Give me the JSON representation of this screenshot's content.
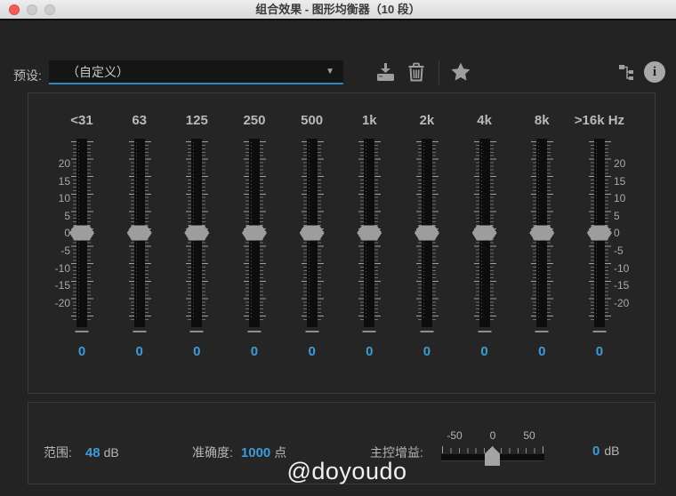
{
  "window": {
    "title": "组合效果 - 图形均衡器（10 段）"
  },
  "toolbar": {
    "preset_label": "预设:",
    "preset_value": "（自定义）",
    "icons": {
      "dropdown": "chevron-down-icon",
      "save": "save-preset-icon",
      "delete": "trash-icon",
      "favorite": "star-icon",
      "routing": "routing-icon",
      "info": "info-icon"
    },
    "info_glyph": "i"
  },
  "equalizer": {
    "scale_ticks": [
      "20",
      "15",
      "10",
      "5",
      "0",
      "-5",
      "-10",
      "-15",
      "-20"
    ],
    "bands": [
      {
        "freq": "<31",
        "value": "0"
      },
      {
        "freq": "63",
        "value": "0"
      },
      {
        "freq": "125",
        "value": "0"
      },
      {
        "freq": "250",
        "value": "0"
      },
      {
        "freq": "500",
        "value": "0"
      },
      {
        "freq": "1k",
        "value": "0"
      },
      {
        "freq": "2k",
        "value": "0"
      },
      {
        "freq": "4k",
        "value": "0"
      },
      {
        "freq": "8k",
        "value": "0"
      },
      {
        "freq": ">16k Hz",
        "value": "0"
      }
    ]
  },
  "footer": {
    "range_label": "范围:",
    "range_value": "48",
    "range_unit": "dB",
    "accuracy_label": "准确度:",
    "accuracy_value": "1000",
    "accuracy_unit": "点",
    "master_gain_label": "主控增益:",
    "gain_scale": [
      "-50",
      "0",
      "50"
    ],
    "gain_value": "0",
    "gain_unit": "dB"
  },
  "watermark": "@doyoudo",
  "colors": {
    "accent_blue": "#3f9bd8",
    "underline_blue": "#2d85c5",
    "panel_bg": "#252525",
    "window_bg": "#232323",
    "handle_gray": "#9d9d9d"
  }
}
